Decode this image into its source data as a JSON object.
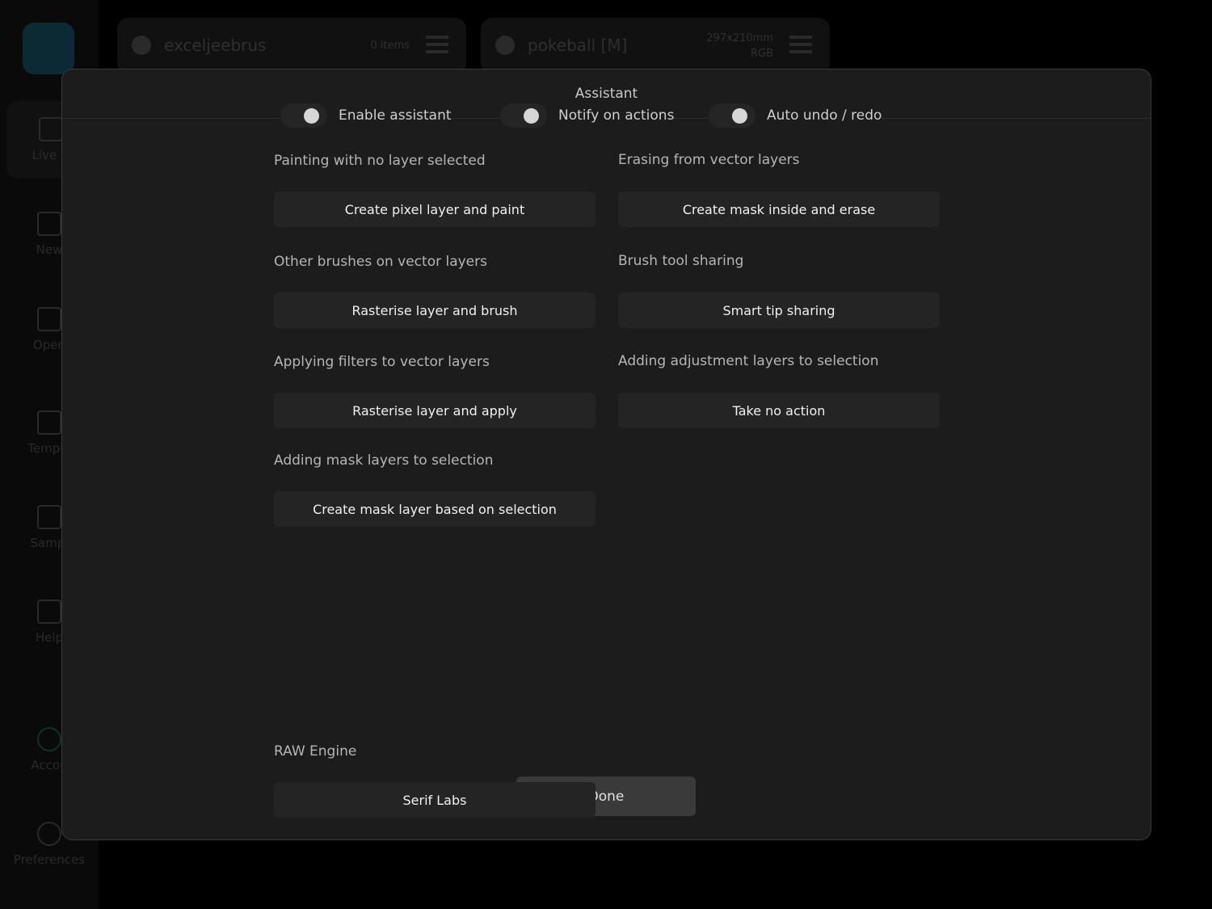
{
  "sidebar": {
    "items": [
      {
        "label": "Live D",
        "icon": "live-docs-icon"
      },
      {
        "label": "New",
        "icon": "new-doc-icon"
      },
      {
        "label": "Open",
        "icon": "folder-icon"
      },
      {
        "label": "Templa",
        "icon": "templates-icon"
      },
      {
        "label": "Sampl",
        "icon": "samples-icon"
      },
      {
        "label": "Help",
        "icon": "book-icon"
      },
      {
        "label": "Accou",
        "icon": "account-icon"
      },
      {
        "label": "Preferences",
        "icon": "gear-icon"
      }
    ]
  },
  "tabs": [
    {
      "name": "exceljeebrus",
      "meta1": "0 items",
      "meta2": ""
    },
    {
      "name": "pokeball [M]",
      "meta1": "297x210mm",
      "meta2": "RGB"
    }
  ],
  "dialog": {
    "title": "Assistant",
    "toggles": [
      {
        "label": "Enable assistant",
        "on": true
      },
      {
        "label": "Notify on actions",
        "on": true
      },
      {
        "label": "Auto undo / redo",
        "on": true
      }
    ],
    "fields": [
      {
        "label": "Painting with no layer selected",
        "value": "Create pixel layer and paint"
      },
      {
        "label": "Erasing from vector layers",
        "value": "Create mask inside and erase"
      },
      {
        "label": "Other brushes on vector layers",
        "value": "Rasterise layer and brush"
      },
      {
        "label": "Brush tool sharing",
        "value": "Smart tip sharing"
      },
      {
        "label": "Applying filters to vector layers",
        "value": "Rasterise layer and apply"
      },
      {
        "label": "Adding adjustment layers to selection",
        "value": "Take no action"
      },
      {
        "label": "Adding mask layers to selection",
        "value": "Create mask layer based on selection"
      },
      {
        "label": "RAW Engine",
        "value": "Serif Labs"
      }
    ],
    "done_label": "Done"
  }
}
